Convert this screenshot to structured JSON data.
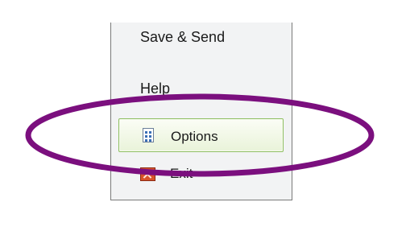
{
  "menu": {
    "items": [
      {
        "label": "Save & Send",
        "icon": ""
      },
      {
        "label": "Help",
        "icon": ""
      },
      {
        "label": "Options",
        "icon": "options-icon",
        "selected": true
      },
      {
        "label": "Exit",
        "icon": "exit-icon"
      }
    ]
  },
  "annotation": {
    "shape": "ellipse",
    "color": "#7b0f7e"
  }
}
